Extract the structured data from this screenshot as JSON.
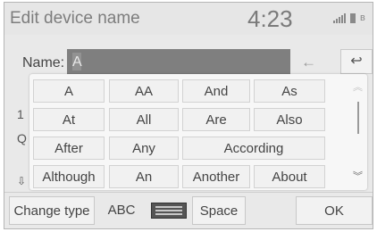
{
  "header": {
    "title": "Edit device name",
    "time": "4:23",
    "signal_icon": "signal-bars-icon",
    "battery_icon": "battery-icon",
    "bluetooth_icon": "bluetooth-icon",
    "bluetooth_glyph": "ʙ"
  },
  "name_field": {
    "label": "Name:",
    "value": "A",
    "backspace_glyph": "←",
    "back_glyph": "↩"
  },
  "side_peek": [
    "1",
    "Q",
    "⇩"
  ],
  "suggestions": {
    "rows": [
      [
        "A",
        "AA",
        "And",
        "As"
      ],
      [
        "At",
        "All",
        "Are",
        "Also"
      ],
      [
        "After",
        "Any",
        "According"
      ],
      [
        "Although",
        "An",
        "Another",
        "About"
      ]
    ],
    "scroll_up_glyph": "︽",
    "scroll_down_glyph": "︾"
  },
  "toolbar": {
    "change_type": "Change type",
    "abc": "ABC",
    "keyboard_icon": "keyboard-icon",
    "space": "Space",
    "ok": "OK"
  },
  "colors": {
    "screen_bg": "#e9e9e9",
    "field_bg": "#7f7f7f",
    "text": "#444444"
  }
}
